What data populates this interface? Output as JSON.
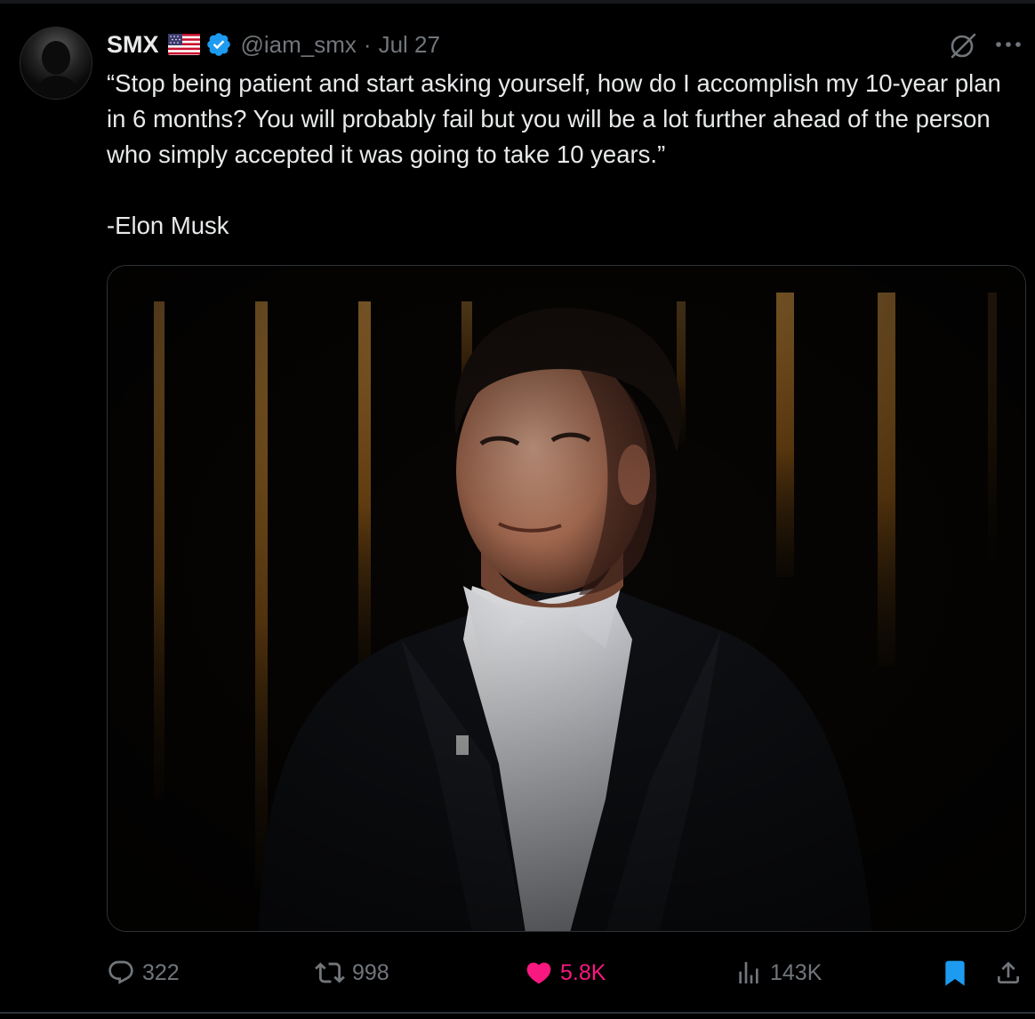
{
  "author": {
    "display_name": "SMX",
    "handle": "@iam_smx",
    "separator": "·",
    "date": "Jul 27"
  },
  "tweet": {
    "quote": "“Stop being patient and start asking yourself, how do I accomplish my 10-year plan in 6 months? You will probably fail but you will be a lot further ahead of the person who simply accepted it was going to take 10 years.”",
    "attribution": "-Elon Musk"
  },
  "icons": {
    "flag": "us-flag-icon",
    "verified": "verified-badge-icon",
    "grok": "grok-icon",
    "more": "more-icon",
    "reply": "reply-icon",
    "repost": "repost-icon",
    "like": "heart-icon",
    "views": "views-icon",
    "bookmark": "bookmark-icon",
    "share": "share-icon"
  },
  "stats": {
    "replies": "322",
    "reposts": "998",
    "likes": "5.8K",
    "views": "143K",
    "liked": true,
    "bookmarked": true
  },
  "colors": {
    "background": "#000000",
    "text_primary": "#e7e9ea",
    "text_secondary": "#71767b",
    "verified_blue": "#1d9bf0",
    "like_pink": "#f91880",
    "border": "#2f3336"
  }
}
